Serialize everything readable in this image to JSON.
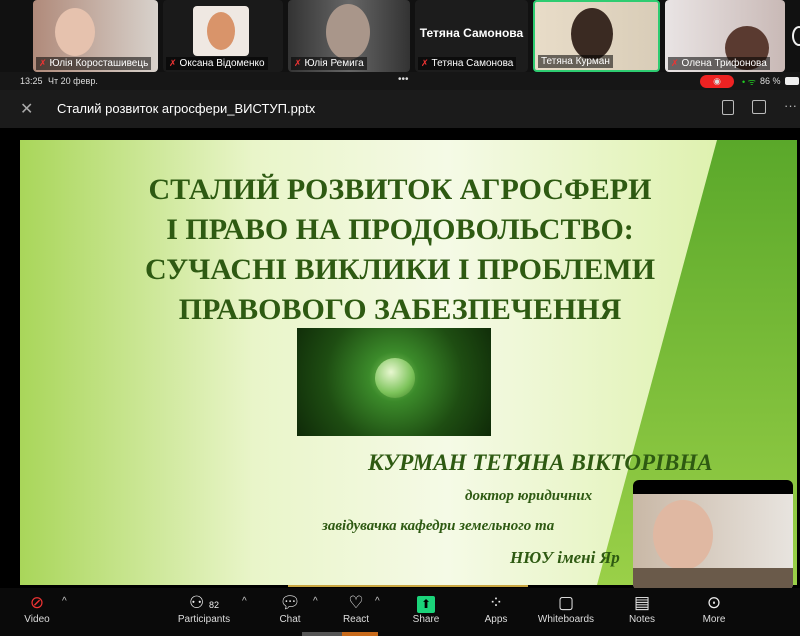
{
  "participants_strip": [
    {
      "name": "Юлія Коросташивець",
      "muted": true
    },
    {
      "name": "Оксана Відоменко",
      "muted": true
    },
    {
      "name": "Юлія Ремига",
      "muted": true
    },
    {
      "name": "Тетяна Самонова",
      "muted": true,
      "video_off_label": "Тетяна Самонова"
    },
    {
      "name": "Тетяна Курман",
      "muted": false,
      "active_speaker": true
    },
    {
      "name": "Олена Трифонова",
      "muted": true
    }
  ],
  "status_bar": {
    "time": "13:25",
    "date": "Чт 20 февр.",
    "battery": "86 %",
    "dots": "•••"
  },
  "header": {
    "file_name": "Сталий розвиток агросфери_ВИСТУП.pptx"
  },
  "slide": {
    "title_lines": [
      "СТАЛИЙ РОЗВИТОК АГРОСФЕРИ",
      "І ПРАВО НА ПРОДОВОЛЬСТВО:",
      "СУЧАСНІ ВИКЛИКИ І ПРОБЛЕМИ",
      "ПРАВОВОГО ЗАБЕЗПЕЧЕННЯ"
    ],
    "author": "КУРМАН  ТЕТЯНА  ВІКТОРІВНА",
    "degree": "доктор юридичних",
    "position": "завідувачка кафедри земельного та",
    "university": "НЮУ імені Яр"
  },
  "toolbar": {
    "video": "Video",
    "participants": "Participants",
    "participants_count": "82",
    "chat": "Chat",
    "react": "React",
    "share": "Share",
    "apps": "Apps",
    "whiteboards": "Whiteboards",
    "notes": "Notes",
    "more": "More"
  }
}
